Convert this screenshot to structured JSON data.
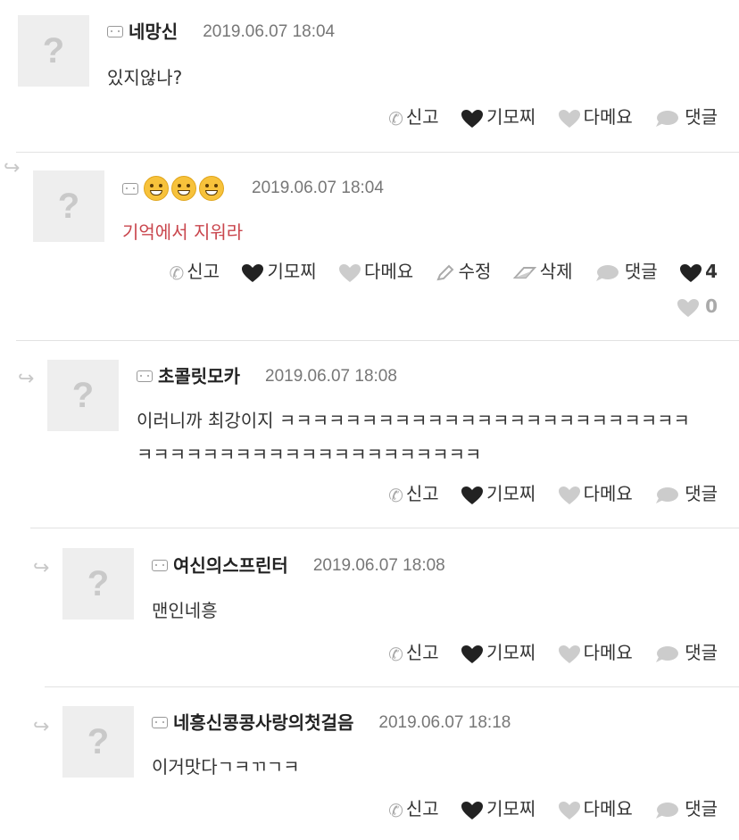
{
  "actions_default": [
    "신고",
    "기모찌",
    "다메요",
    "댓글"
  ],
  "comments": [
    {
      "nick": "네망신",
      "date": "2019.06.07 18:04",
      "text_lines": [
        "있지않나?"
      ],
      "actions": {
        "report": "신고",
        "like": "기모찌",
        "dislike": "다메요",
        "reply": "댓글"
      }
    },
    {
      "nick": "",
      "emoji": [
        "grinning-face",
        "grinning-face",
        "grinning-face"
      ],
      "date": "2019.06.07 18:04",
      "text_lines": [
        "기억에서 지워라"
      ],
      "actions": {
        "report": "신고",
        "like": "기모찌",
        "dislike": "다메요",
        "edit": "수정",
        "delete": "삭제",
        "reply": "댓글"
      },
      "like_count": "4",
      "dislike_count": "0"
    },
    {
      "nick": "초콜릿모카",
      "date": "2019.06.07 18:08",
      "text_lines": [
        "이러니까 최강이지 ㅋㅋㅋㅋㅋㅋㅋㅋㅋㅋㅋㅋㅋㅋㅋㅋㅋㅋㅋㅋㅋㅋㅋㅋㅋ",
        "ㅋㅋㅋㅋㅋㅋㅋㅋㅋㅋㅋㅋㅋㅋㅋㅋㅋㅋㅋㅋㅋ"
      ],
      "actions": {
        "report": "신고",
        "like": "기모찌",
        "dislike": "다메요",
        "reply": "댓글"
      }
    },
    {
      "nick": "여신의스프린터",
      "date": "2019.06.07 18:08",
      "text_lines": [
        "맨인네흥"
      ],
      "actions": {
        "report": "신고",
        "like": "기모찌",
        "dislike": "다메요",
        "reply": "댓글"
      }
    },
    {
      "nick": "네흥신콩콩사랑의첫걸음",
      "date": "2019.06.07 18:18",
      "text_lines": [
        "이거맛다ㄱㅋㄲㄱㅋ"
      ],
      "actions": {
        "report": "신고",
        "like": "기모찌",
        "dislike": "다메요",
        "reply": "댓글"
      }
    }
  ],
  "avatar_placeholder": "?",
  "colors": {
    "like_heart": "#222222",
    "dislike_heart": "#cccccc",
    "red_text": "#c9464d",
    "date": "#777777"
  }
}
